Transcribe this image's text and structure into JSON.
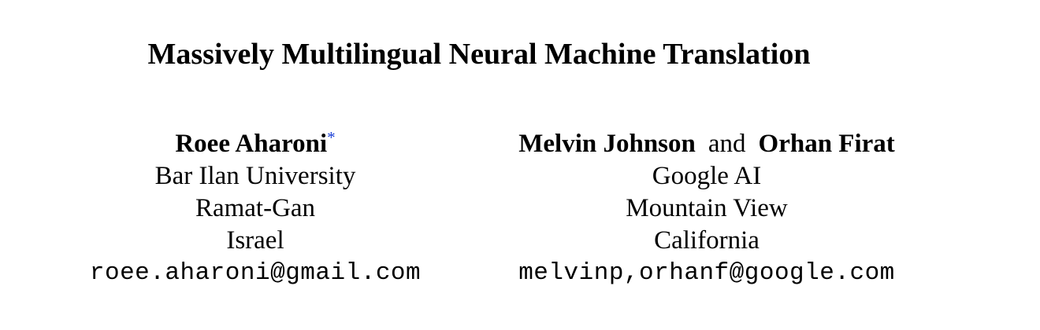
{
  "paper": {
    "title": "Massively Multilingual Neural Machine Translation",
    "authors_left": {
      "name": "Roee Aharoni",
      "footnote_mark": "*",
      "affiliation": "Bar Ilan University",
      "city": "Ramat-Gan",
      "country": "Israel",
      "email": "roee.aharoni@gmail.com"
    },
    "authors_right": {
      "name_1": "Melvin Johnson",
      "conjunction": "and",
      "name_2": "Orhan Firat",
      "affiliation": "Google AI",
      "city": "Mountain View",
      "region": "California",
      "email": "melvinp,orhanf@google.com"
    },
    "colors": {
      "text": "#000000",
      "footnote_link": "#1a3fd6",
      "background": "#ffffff"
    }
  }
}
